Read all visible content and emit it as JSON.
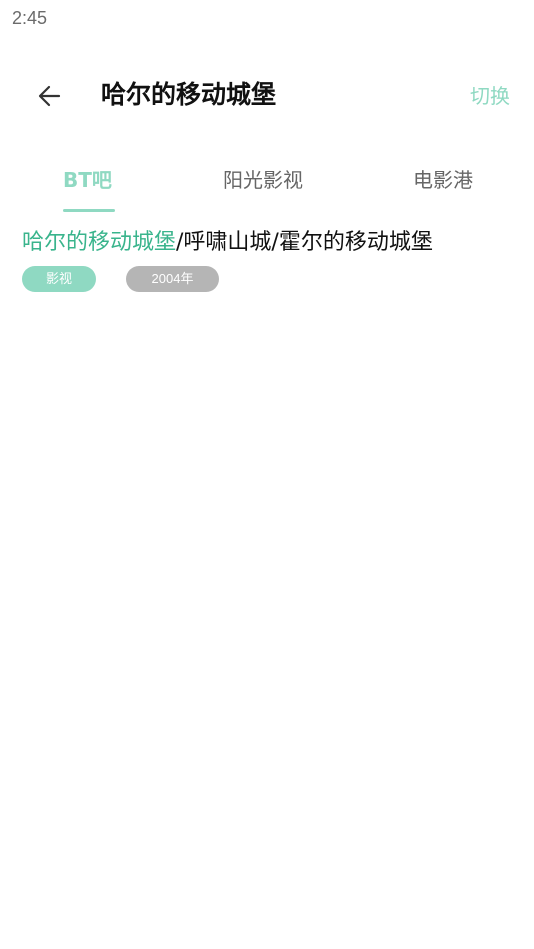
{
  "status_bar": {
    "time": "2:45"
  },
  "header": {
    "title": "哈尔的移动城堡",
    "switch_label": "切换",
    "back_icon": "arrow-left-icon"
  },
  "tabs": [
    {
      "label": "BT吧",
      "active": true
    },
    {
      "label": "阳光影视",
      "active": false
    },
    {
      "label": "电影港",
      "active": false
    }
  ],
  "results": [
    {
      "title_highlight": "哈尔的移动城堡",
      "title_rest": "/呼啸山城/霍尔的移动城堡",
      "tag_type": "影视",
      "tag_year": "2004年"
    }
  ],
  "colors": {
    "accent": "#8fd9c2",
    "highlight": "#39b48c",
    "tag_gray": "#b5b5b5"
  }
}
